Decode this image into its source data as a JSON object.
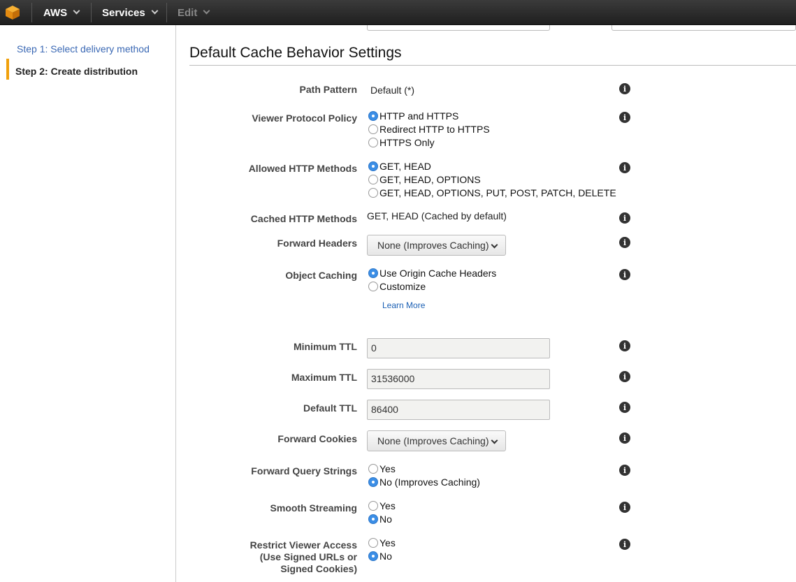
{
  "topbar": {
    "brand": "AWS",
    "services": "Services",
    "edit": "Edit"
  },
  "sidebar": {
    "steps": [
      {
        "label": "Step 1: Select delivery method"
      },
      {
        "label": "Step 2: Create distribution"
      }
    ]
  },
  "section": {
    "title": "Default Cache Behavior Settings"
  },
  "fields": {
    "path_pattern": {
      "label": "Path Pattern",
      "value": "Default (*)"
    },
    "viewer_protocol": {
      "label": "Viewer Protocol Policy",
      "options": [
        "HTTP and HTTPS",
        "Redirect HTTP to HTTPS",
        "HTTPS Only"
      ],
      "selected": "HTTP and HTTPS"
    },
    "allowed_methods": {
      "label": "Allowed HTTP Methods",
      "options": [
        "GET, HEAD",
        "GET, HEAD, OPTIONS",
        "GET, HEAD, OPTIONS, PUT, POST, PATCH, DELETE"
      ],
      "selected": "GET, HEAD"
    },
    "cached_methods": {
      "label": "Cached HTTP Methods",
      "value": "GET, HEAD (Cached by default)"
    },
    "forward_headers": {
      "label": "Forward Headers",
      "value": "None (Improves Caching)"
    },
    "object_caching": {
      "label": "Object Caching",
      "options": [
        "Use Origin Cache Headers",
        "Customize"
      ],
      "selected": "Use Origin Cache Headers",
      "link": "Learn More"
    },
    "min_ttl": {
      "label": "Minimum TTL",
      "value": "0"
    },
    "max_ttl": {
      "label": "Maximum TTL",
      "value": "31536000"
    },
    "default_ttl": {
      "label": "Default TTL",
      "value": "86400"
    },
    "forward_cookies": {
      "label": "Forward Cookies",
      "value": "None (Improves Caching)"
    },
    "forward_query": {
      "label": "Forward Query Strings",
      "options": [
        "Yes",
        "No (Improves Caching)"
      ],
      "selected": "No (Improves Caching)"
    },
    "smooth_streaming": {
      "label": "Smooth Streaming",
      "options": [
        "Yes",
        "No"
      ],
      "selected": "No"
    },
    "restrict_viewer": {
      "label_line1": "Restrict Viewer Access",
      "label_line2": "(Use Signed URLs or",
      "label_line3": "Signed Cookies)",
      "options": [
        "Yes",
        "No"
      ],
      "selected": "No"
    }
  },
  "icons": {
    "info": "i"
  },
  "colors": {
    "accent": "#f0a00b",
    "radio_selected": "#3b8ee6",
    "link": "#1a5fb4"
  }
}
